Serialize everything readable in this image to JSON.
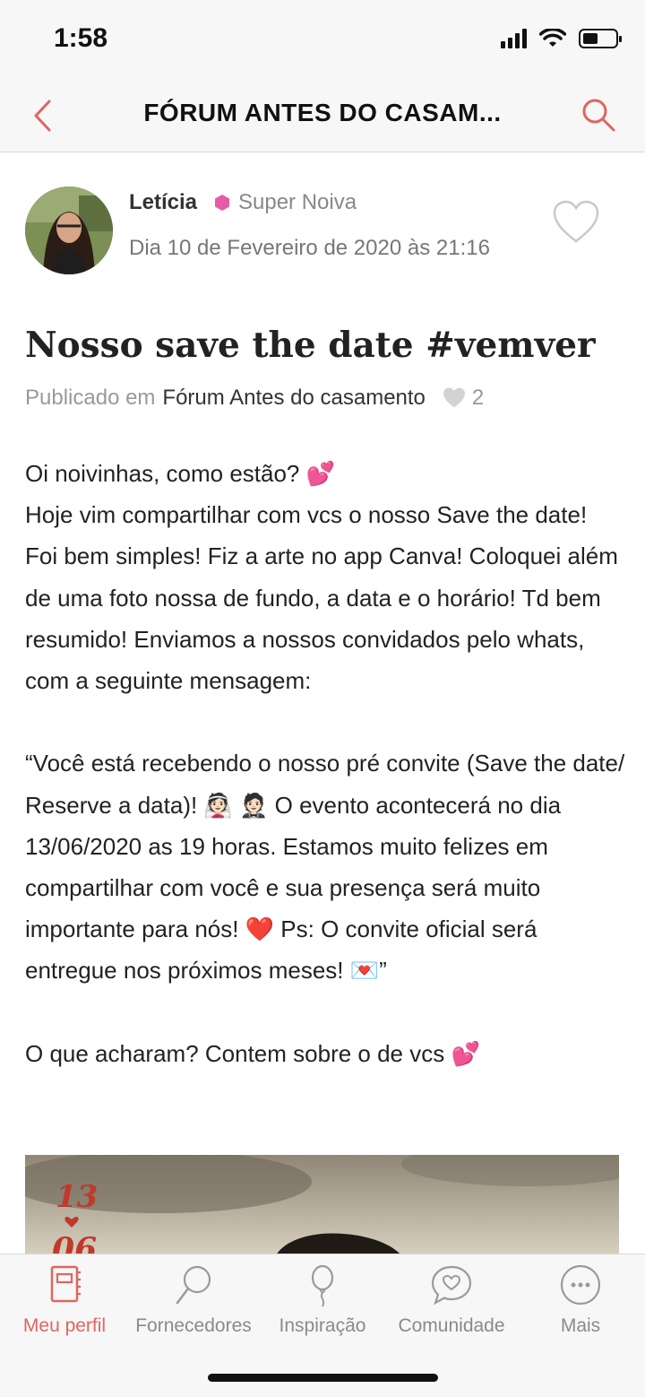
{
  "status_bar": {
    "time": "1:58"
  },
  "nav": {
    "title": "FÓRUM ANTES DO CASAM..."
  },
  "author": {
    "name": "Letícia",
    "rank": "Super Noiva",
    "date": "Dia 10 de Fevereiro de 2020 às 21:16"
  },
  "post": {
    "title": "Nosso save the date #vemver",
    "published_prefix": "Publicado em",
    "forum": "Fórum Antes do casamento",
    "likes": "2",
    "paragraphs": {
      "p1_line1": "Oi noivinhas, como estão? 💕",
      "p1_rest": "Hoje vim compartilhar com vcs o nosso Save the date! Foi bem simples! Fiz a arte no app Canva! Coloquei além de uma foto nossa de fundo, a data e o horário! Td bem resumido! Enviamos a nossos convidados pelo whats, com a seguinte mensagem:",
      "p2": "“Você está recebendo o nosso pré convite (Save the date/ Reserve a data)! 👰🏻 🤵🏻 O evento acontecerá no dia 13/06/2020 as 19 horas. Estamos muito felizes em compartilhar com você e sua presença será muito importante para nós! ❤️ Ps: O convite oficial será entregue nos próximos meses! 💌”",
      "p3": "O que acharam? Contem sobre o de vcs 💕"
    },
    "image_overlay": {
      "day": "13",
      "month": "06"
    }
  },
  "tabs": [
    {
      "label": "Meu perfil",
      "icon": "profile-book-icon",
      "active": true
    },
    {
      "label": "Fornecedores",
      "icon": "magnifier-icon",
      "active": false
    },
    {
      "label": "Inspiração",
      "icon": "balloon-icon",
      "active": false
    },
    {
      "label": "Comunidade",
      "icon": "chat-heart-icon",
      "active": false
    },
    {
      "label": "Mais",
      "icon": "more-dots-icon",
      "active": false
    }
  ],
  "colors": {
    "accent": "#e0655f",
    "rank_badge": "#e85aa6",
    "muted": "#999999"
  }
}
